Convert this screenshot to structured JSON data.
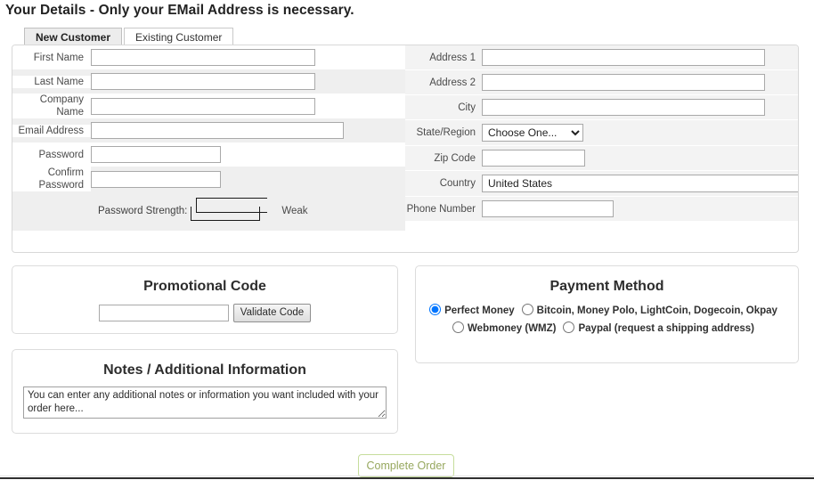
{
  "page": {
    "title": "Your Details - Only your EMail Address is necessary."
  },
  "tabs": [
    {
      "label": "New Customer",
      "active": true
    },
    {
      "label": "Existing Customer",
      "active": false
    }
  ],
  "details": {
    "left_fields": [
      {
        "label": "First Name",
        "value": "",
        "placeholder": ""
      },
      {
        "label": "Last Name",
        "value": "",
        "placeholder": ""
      },
      {
        "label": "Company Name",
        "value": "",
        "placeholder": ""
      },
      {
        "label": "Email Address",
        "value": "",
        "placeholder": ""
      },
      {
        "label": "Password",
        "value": "",
        "placeholder": ""
      },
      {
        "label": "Confirm Password",
        "value": "",
        "placeholder": ""
      }
    ],
    "password_strength": {
      "label": "Password Strength:",
      "verdict": "Weak"
    },
    "right_fields": [
      {
        "label": "Address 1",
        "value": ""
      },
      {
        "label": "Address 2",
        "value": ""
      },
      {
        "label": "City",
        "value": ""
      },
      {
        "label": "Zip Code",
        "value": ""
      },
      {
        "label": "Phone Number",
        "value": ""
      }
    ],
    "state": {
      "label": "State/Region",
      "selected": "Choose One...",
      "options": [
        "Choose One..."
      ]
    },
    "country": {
      "label": "Country",
      "selected": "United States",
      "options": [
        "United States"
      ]
    }
  },
  "promotional": {
    "title": "Promotional Code",
    "input_value": "",
    "input_placeholder": "",
    "validate_label": "Validate Code"
  },
  "payment": {
    "title": "Payment Method",
    "options": [
      {
        "label": "Perfect Money",
        "selected": true
      },
      {
        "label": "Bitcoin, Money Polo, LightCoin, Dogecoin, Okpay",
        "selected": false
      },
      {
        "label": "Webmoney (WMZ)",
        "selected": false
      },
      {
        "label": "Paypal (request a shipping address)",
        "selected": false
      }
    ]
  },
  "notes": {
    "title": "Notes / Additional Information",
    "value": "You can enter any additional notes or information you want included with your order here...",
    "placeholder": "You can enter any additional notes or information you want included with your order here..."
  },
  "footer": {
    "complete_label": "Complete Order"
  },
  "colors": {
    "accent_green": "#97a85f",
    "accent_green_border": "#c6dd9c",
    "row_gray": "#efefef",
    "panel_border": "#dcdcdc"
  }
}
